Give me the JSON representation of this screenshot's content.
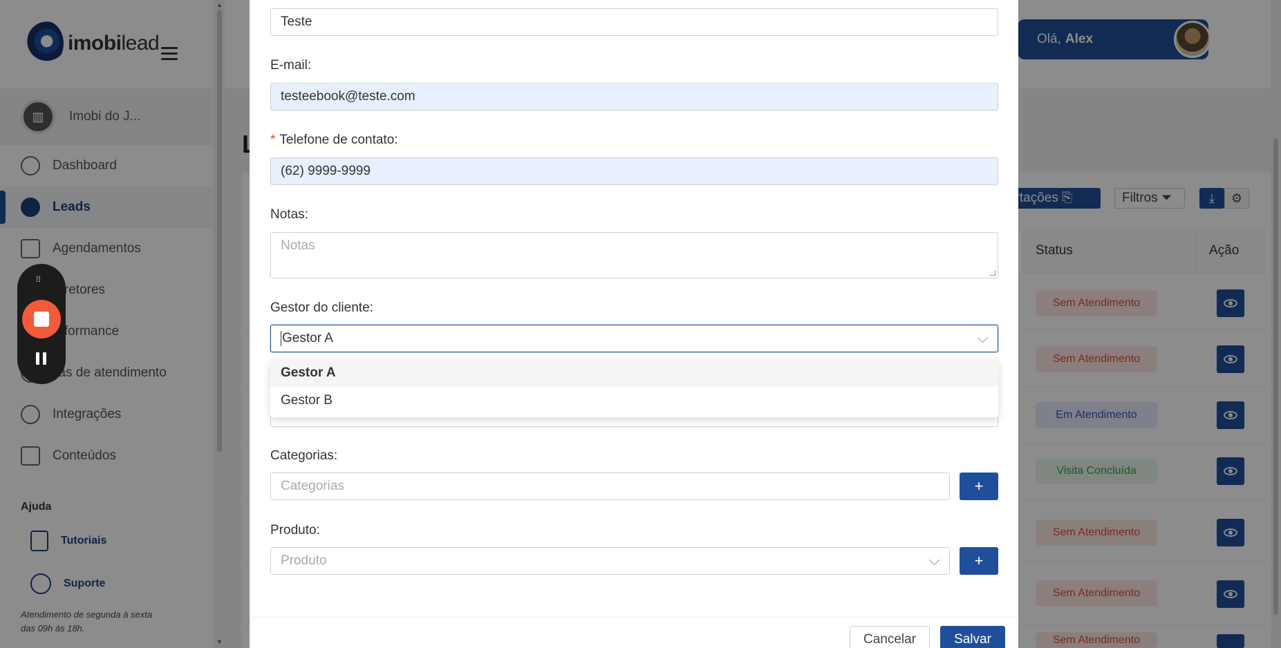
{
  "sidebar": {
    "logo_text_bold": "imobi",
    "logo_text_light": "lead",
    "company_name": "Imobi do J...",
    "items": [
      {
        "label": "Dashboard",
        "icon": "clock-icon"
      },
      {
        "label": "Leads",
        "icon": "user-icon"
      },
      {
        "label": "Agendamentos",
        "icon": "calendar-icon"
      },
      {
        "label": "Corretores",
        "icon": "people-icon"
      },
      {
        "label": "Performance",
        "icon": "chart-icon"
      },
      {
        "label": "Filas de atendimento",
        "icon": "queue-icon"
      },
      {
        "label": "Integrações",
        "icon": "bolt-icon"
      },
      {
        "label": "Conteúdos",
        "icon": "grid-icon"
      }
    ],
    "nav_visible": [
      "Dashboard",
      "Leads",
      "Agendamentos",
      "orretores",
      "erformance",
      "ilas de atendimento",
      "Integrações",
      "Conteúdos"
    ],
    "help_title": "Ajuda",
    "tutorials": "Tutoriais",
    "support": "Suporte",
    "hours_line1": "Atendimento de segunda à sexta",
    "hours_line2": "das 09h às 18h."
  },
  "header": {
    "greeting": "Olá,",
    "user_name": "Alex"
  },
  "main": {
    "title_fragment": "L",
    "toolbar": {
      "imports": "ortações",
      "filters": "Filtros"
    },
    "table": {
      "col_status": "Status",
      "col_action": "Ação",
      "rows": [
        {
          "status": "Sem Atendimento",
          "kind": "sem"
        },
        {
          "status": "Sem Atendimento",
          "kind": "sem"
        },
        {
          "status": "Em Atendimento",
          "kind": "em"
        },
        {
          "status": "Visita Concluída",
          "kind": "vis"
        },
        {
          "status": "Sem Atendimento",
          "kind": "sem"
        },
        {
          "status": "Sem Atendimento",
          "kind": "sem"
        },
        {
          "status": "Sem Atendimento",
          "kind": "sem"
        }
      ]
    }
  },
  "modal": {
    "name_value": "Teste",
    "email_label": "E-mail:",
    "email_value": "testeebook@teste.com",
    "phone_label": "Telefone de contato:",
    "phone_value": "(62) 9999-9999",
    "notes_label": "Notas:",
    "notes_placeholder": "Notas",
    "manager_label": "Gestor do cliente:",
    "manager_value": "Gestor A",
    "manager_options": [
      "Gestor A",
      "Gestor B"
    ],
    "categories_label": "Categorias:",
    "categories_placeholder": "Categorias",
    "product_label": "Produto:",
    "product_placeholder": "Produto",
    "cancel": "Cancelar",
    "save": "Salvar"
  },
  "recorder": {
    "dots": "⠿"
  }
}
